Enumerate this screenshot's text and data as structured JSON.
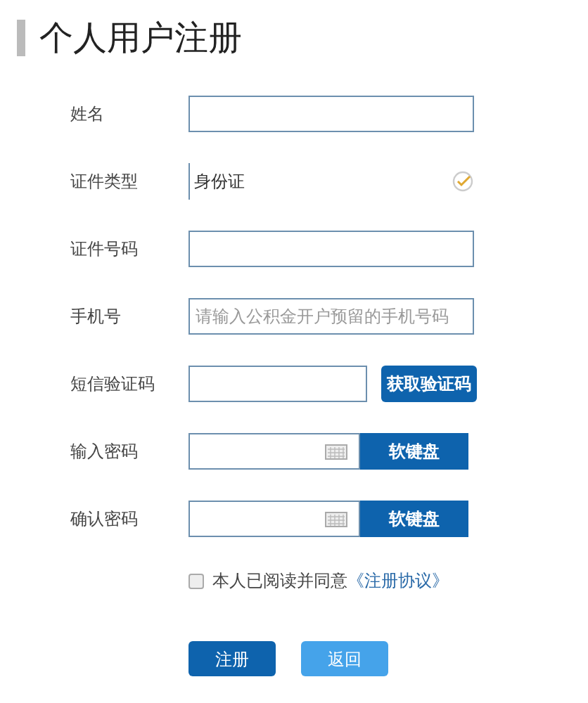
{
  "title": "个人用户注册",
  "fields": [
    {
      "kind": "text",
      "label": "姓名"
    },
    {
      "kind": "select",
      "label": "证件类型",
      "value": "身份证"
    },
    {
      "kind": "text",
      "label": "证件号码"
    },
    {
      "kind": "text",
      "label": "手机号",
      "placeholder": "请输入公积金开户预留的手机号码"
    },
    {
      "kind": "sms",
      "label": "短信验证码",
      "button": "获取验证码"
    },
    {
      "kind": "password",
      "label": "输入密码",
      "button": "软键盘"
    },
    {
      "kind": "password",
      "label": "确认密码",
      "button": "软键盘"
    }
  ],
  "agreement": {
    "checked": false,
    "text": "本人已阅读并同意",
    "link": "《注册协议》"
  },
  "buttons": [
    {
      "label": "注册",
      "kind": "primary"
    },
    {
      "label": "返回",
      "kind": "secondary"
    }
  ]
}
